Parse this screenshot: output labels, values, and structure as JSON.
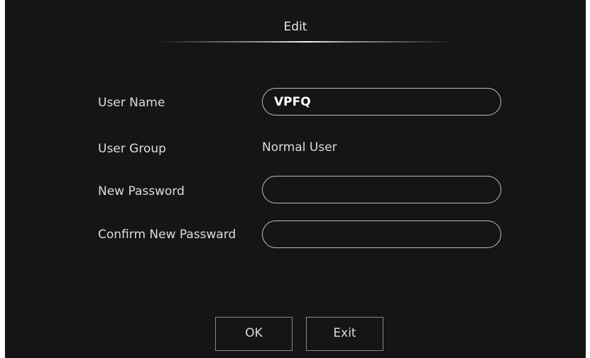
{
  "dialog": {
    "title": "Edit"
  },
  "form": {
    "user_name_label": "User Name",
    "user_name_value": "VPFQ",
    "user_group_label": "User Group",
    "user_group_value": "Normal User",
    "new_password_label": "New Password",
    "new_password_value": "",
    "confirm_password_label": "Confirm New Passward",
    "confirm_password_value": ""
  },
  "buttons": {
    "ok_label": "OK",
    "exit_label": "Exit"
  },
  "colors": {
    "background": "#151515",
    "text": "#dcdcdc",
    "field_border": "#bdbdbd"
  }
}
